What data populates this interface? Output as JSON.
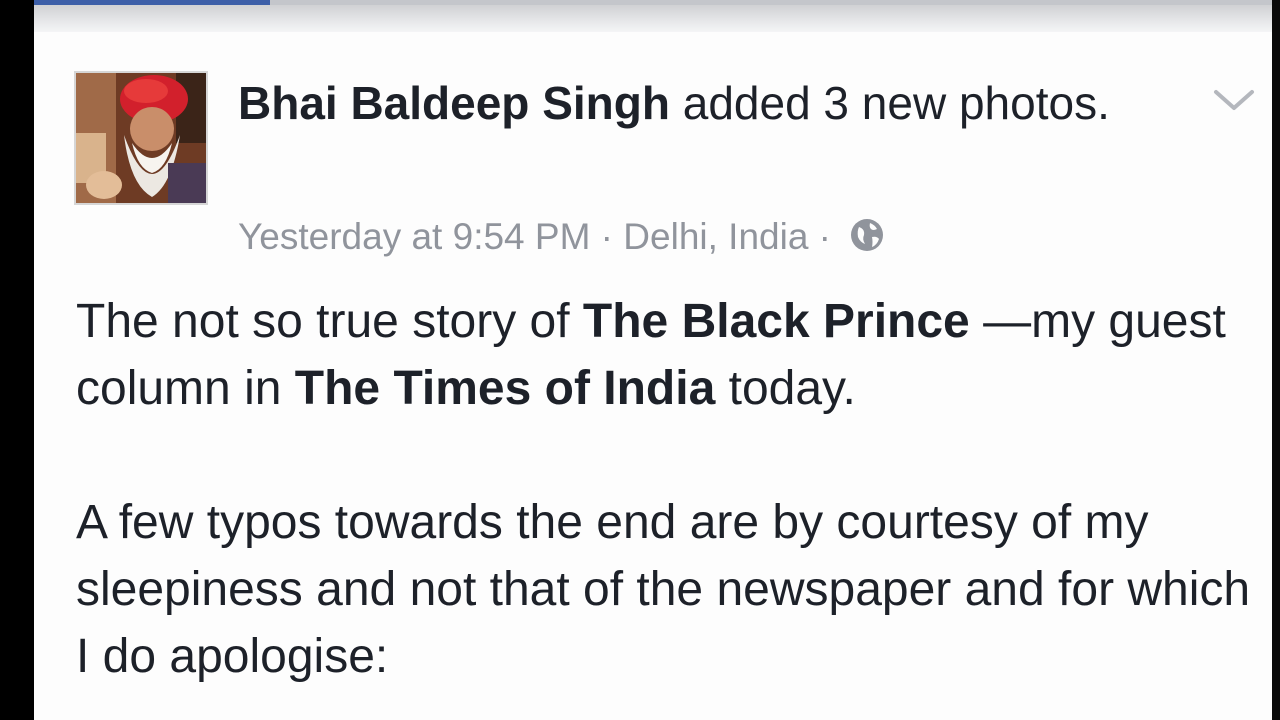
{
  "post": {
    "author_name": "Bhai Baldeep Singh",
    "action_text": " added 3 new photos.",
    "timestamp": "Yesterday at 9:54 PM",
    "separator": " · ",
    "location": "Delhi, India",
    "privacy_icon": "globe-icon",
    "menu_icon": "chevron-down-icon",
    "paragraph1": {
      "text1": "The not so true story of ",
      "bold1": "The Black Prince",
      "text2": " —my guest column in ",
      "bold2": "The Times of India",
      "text3": " today."
    },
    "paragraph2": "A few typos towards the end are by courtesy of my sleepiness and not that of the newspaper and for which I do apologise:"
  },
  "loading_bar": {
    "progress_percent": 19,
    "color": "#3d5fa8"
  },
  "colors": {
    "text_primary": "#1d2129",
    "text_secondary": "#90949c"
  }
}
